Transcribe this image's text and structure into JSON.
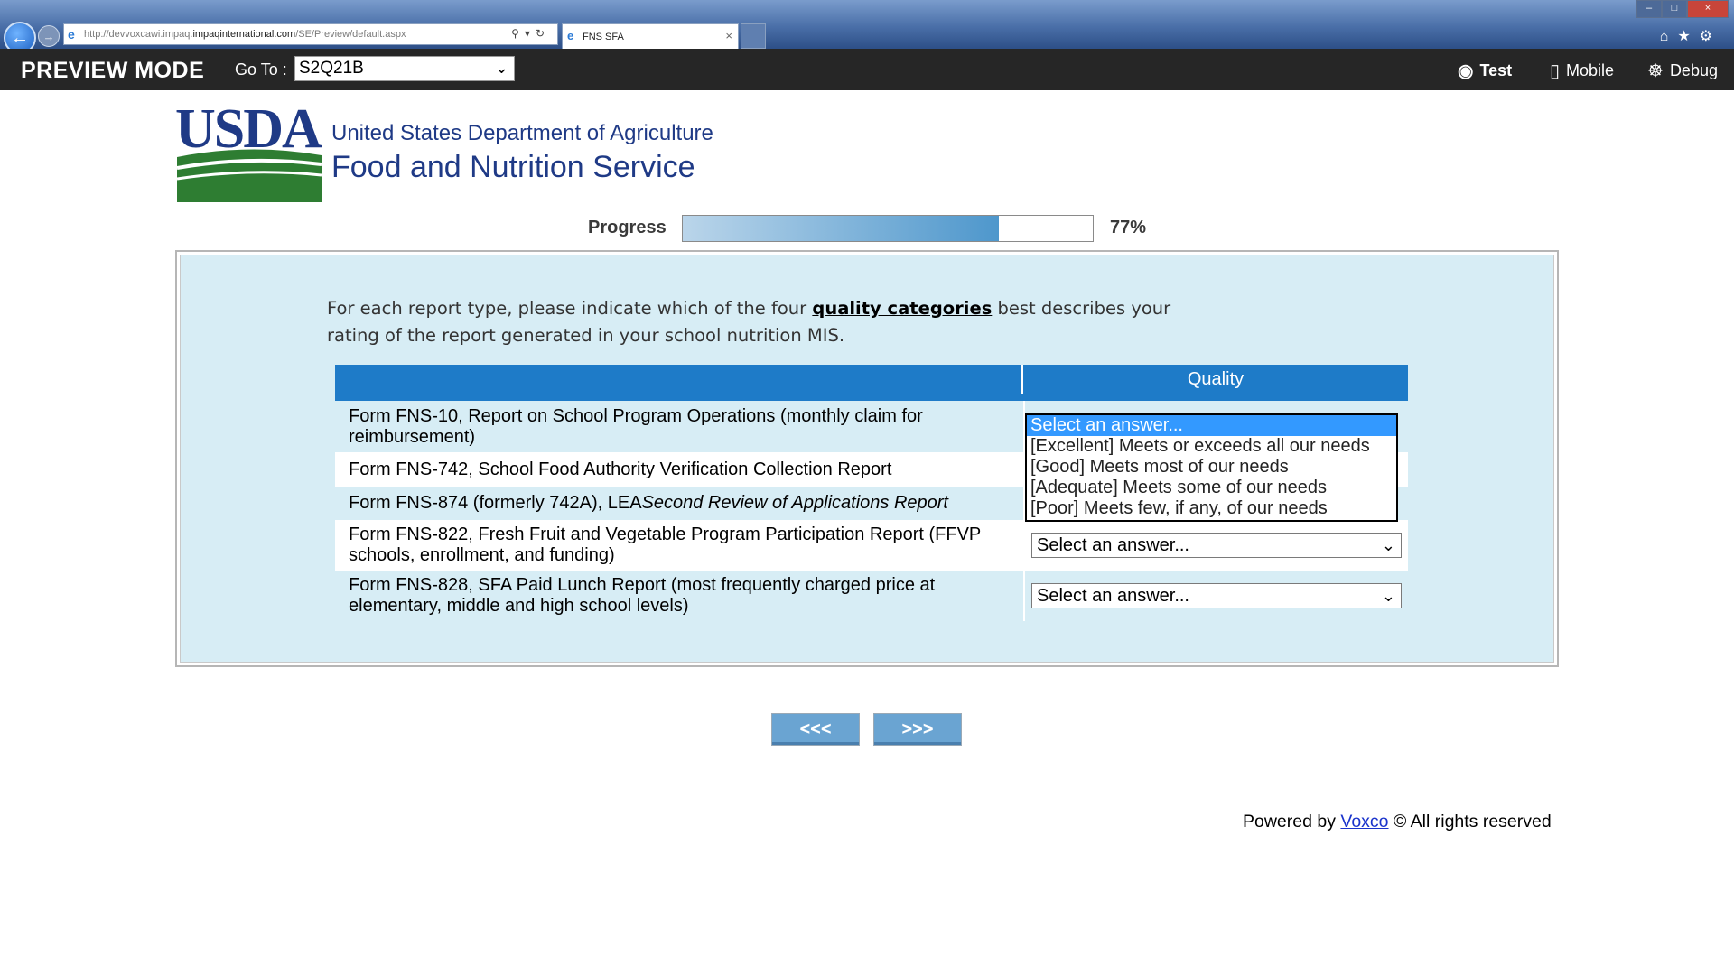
{
  "browser": {
    "url_prefix": "http://devvoxcawi.impaq.",
    "url_domain": "impaqinternational.com",
    "url_path": "/SE/Preview/default.aspx",
    "tab_title": "FNS SFA"
  },
  "toolbar": {
    "title": "PREVIEW MODE",
    "goto_label": "Go To :",
    "goto_value": "S2Q21B",
    "test_label": "Test",
    "mobile_label": "Mobile",
    "debug_label": "Debug"
  },
  "header": {
    "logo_text": "USDA",
    "agency_line1": "United States Department of Agriculture",
    "agency_line2": "Food and Nutrition Service"
  },
  "progress": {
    "label": "Progress",
    "value": 0.77,
    "percent_text": "77%"
  },
  "question": {
    "text_before": "For each report type, please indicate which of the four ",
    "link_text": "quality categories",
    "text_after": " best describes your rating of the report generated in your school nutrition MIS.",
    "column_header": "Quality",
    "rows": [
      {
        "label": "Form FNS-10, Report on School Program Operations (monthly claim for reimbursement)"
      },
      {
        "label": "Form FNS-742, School Food Authority Verification Collection Report"
      },
      {
        "label_prefix": "Form FNS-874 (formerly 742A), LEA ",
        "label_italic": "Second Review of Applications Report"
      },
      {
        "label": "Form FNS-822, Fresh Fruit and Vegetable Program Participation Report (FFVP schools, enrollment, and funding)",
        "selected": "Select an answer..."
      },
      {
        "label": "Form FNS-828, SFA Paid Lunch Report (most frequently charged price at elementary, middle and high school levels)",
        "selected": "Select an answer..."
      }
    ],
    "dropdown_options": [
      "Select an answer...",
      "[Excellent] Meets or exceeds all our needs",
      "[Good] Meets most of our needs",
      "[Adequate] Meets some of our needs",
      "[Poor] Meets few, if any, of our needs"
    ]
  },
  "navigation": {
    "prev_label": "<<<",
    "next_label": ">>>"
  },
  "footer": {
    "powered_by": "Powered by ",
    "brand": "Voxco",
    "rights": " © All rights reserved"
  },
  "colors": {
    "panel_bg": "#d7edf5",
    "header_blue": "#1e7bc8",
    "button_blue": "#6aa4d2",
    "toolbar_bg": "#262626",
    "usda_blue": "#1f3a86",
    "usda_green": "#2e7d32"
  }
}
